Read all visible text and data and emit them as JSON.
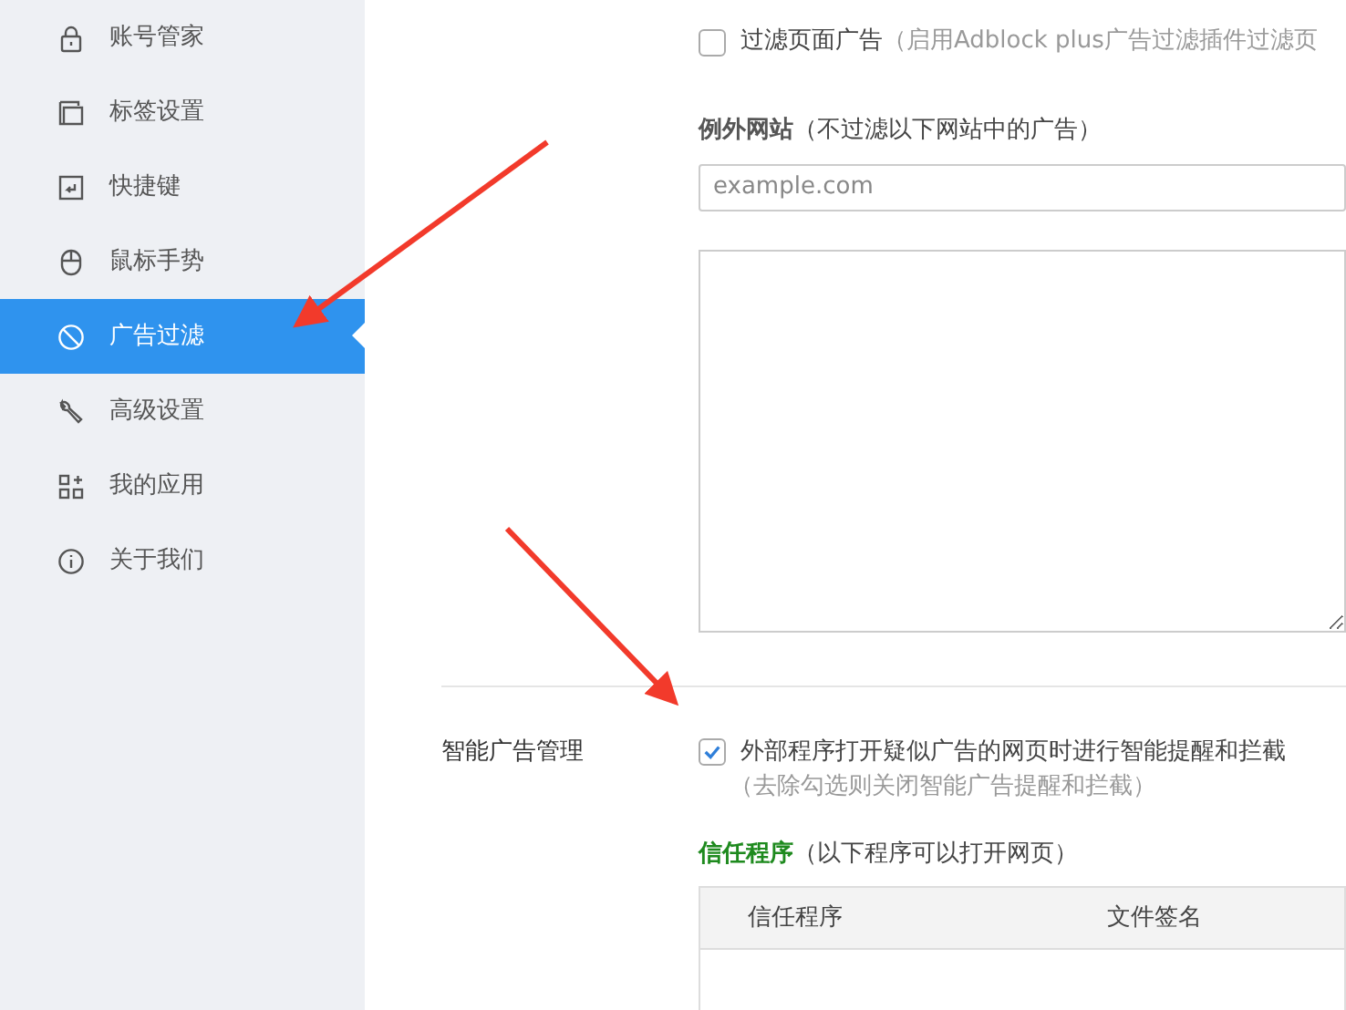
{
  "sidebar": {
    "items": [
      {
        "label": "账号管家",
        "selected": false,
        "kind": "lock"
      },
      {
        "label": "标签设置",
        "selected": false,
        "kind": "tabs"
      },
      {
        "label": "快捷键",
        "selected": false,
        "kind": "key"
      },
      {
        "label": "鼠标手势",
        "selected": false,
        "kind": "mouse"
      },
      {
        "label": "广告过滤",
        "selected": true,
        "kind": "block"
      },
      {
        "label": "高级设置",
        "selected": false,
        "kind": "wrench"
      },
      {
        "label": "我的应用",
        "selected": false,
        "kind": "apps"
      },
      {
        "label": "关于我们",
        "selected": false,
        "kind": "info"
      }
    ]
  },
  "page_filter": {
    "checked": false,
    "label": "过滤页面广告",
    "hint": "（启用Adblock plus广告过滤插件过滤页"
  },
  "exceptions": {
    "title": "例外网站",
    "hint": "（不过滤以下网站中的广告）",
    "placeholder": "example.com"
  },
  "smart": {
    "label": "智能广告管理",
    "checked": true,
    "text": "外部程序打开疑似广告的网页时进行智能提醒和拦截",
    "hint": "（去除勾选则关闭智能广告提醒和拦截）"
  },
  "trusted": {
    "title": "信任程序",
    "hint": "（以下程序可以打开网页）",
    "columns": [
      "信任程序",
      "文件签名"
    ]
  }
}
